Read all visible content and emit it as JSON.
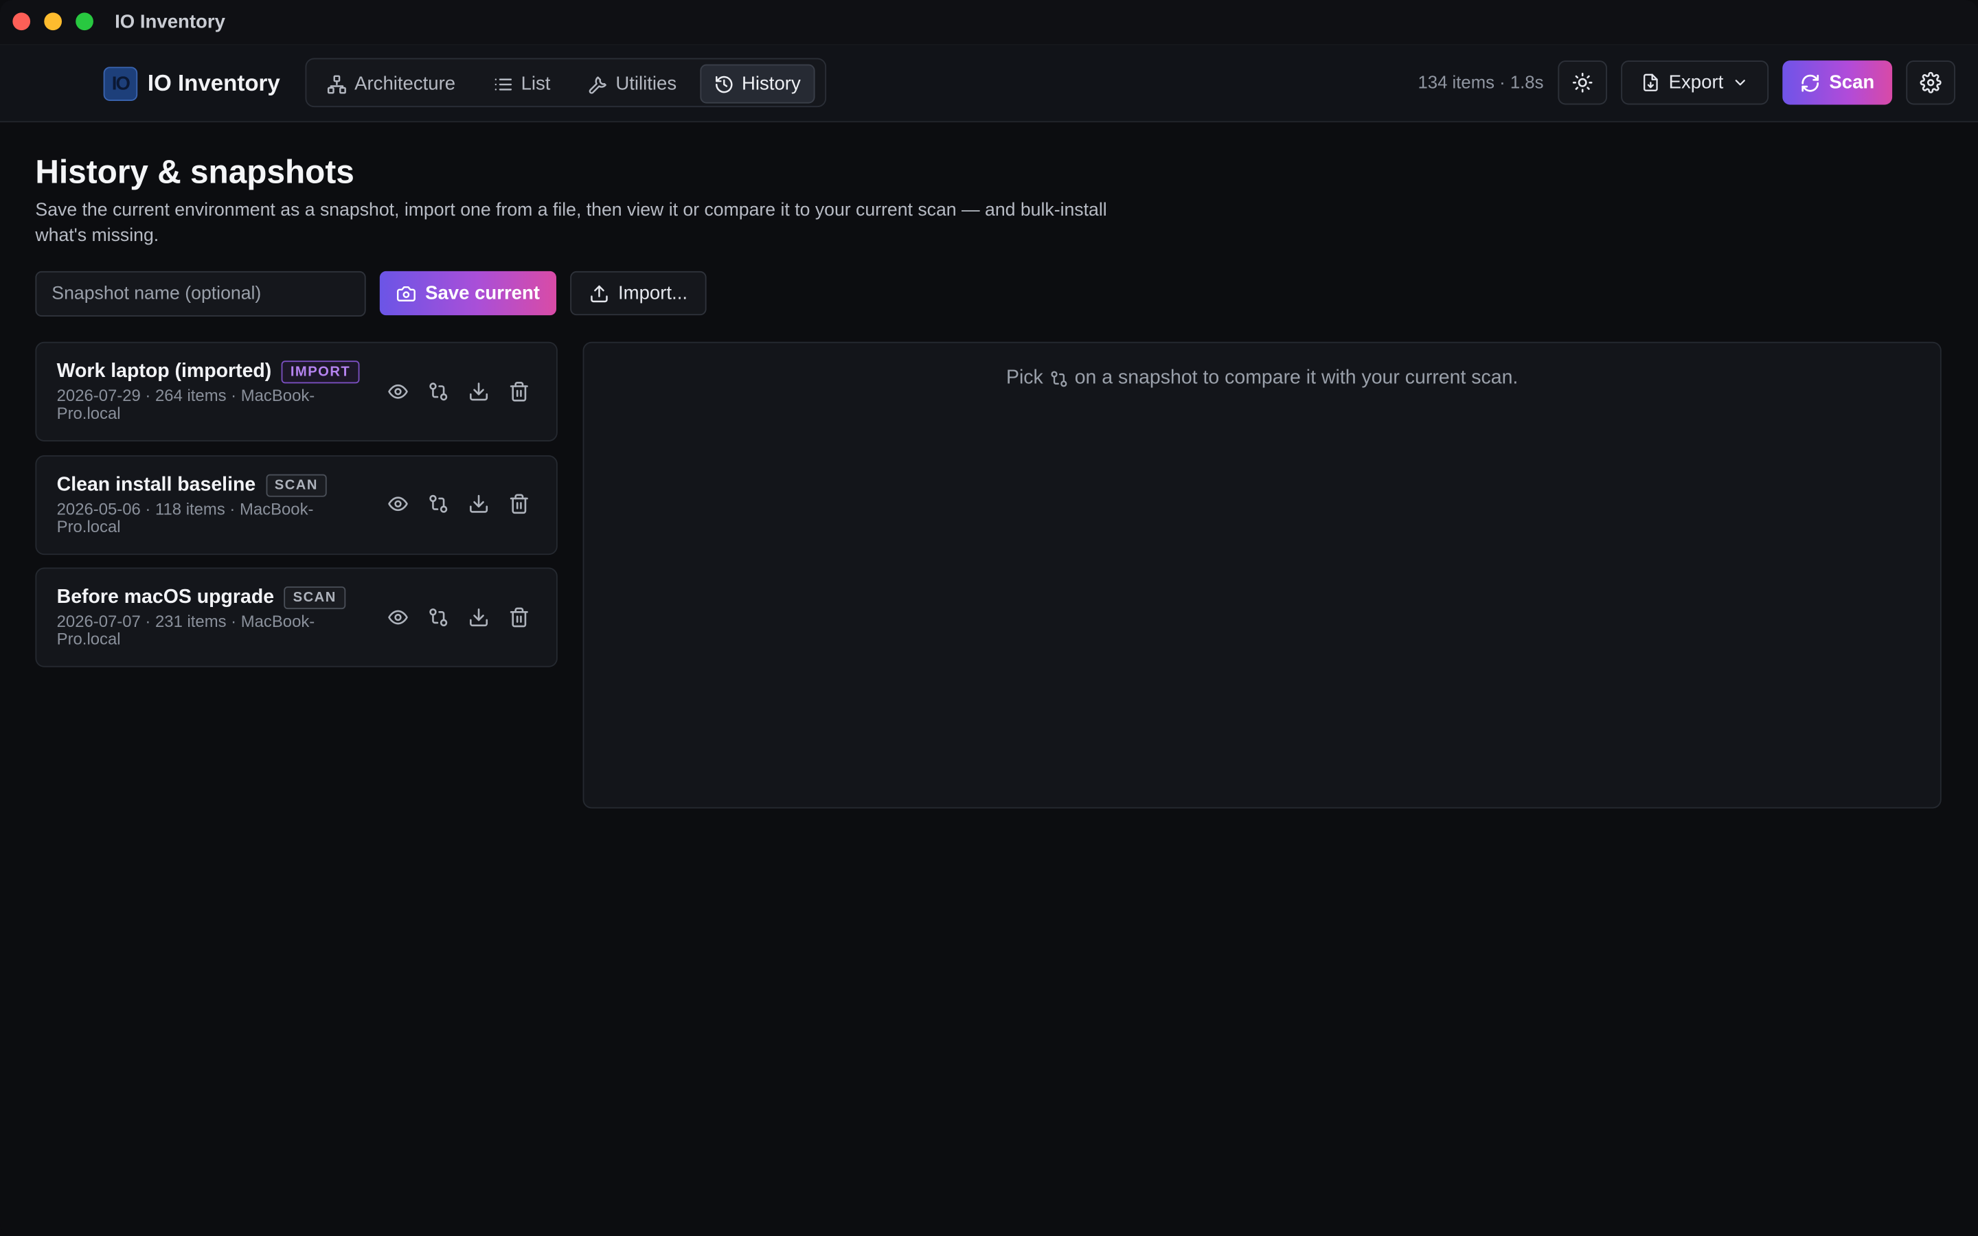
{
  "window": {
    "title": "IO Inventory"
  },
  "brand": {
    "logo_text": "IO",
    "name": "IO Inventory"
  },
  "nav": {
    "tabs": [
      {
        "label": "Architecture",
        "icon": "architecture-icon"
      },
      {
        "label": "List",
        "icon": "list-icon"
      },
      {
        "label": "Utilities",
        "icon": "wrench-icon"
      },
      {
        "label": "History",
        "icon": "history-icon",
        "active": true
      }
    ]
  },
  "header": {
    "stats": "134 items · 1.8s",
    "theme_icon": "sun-icon",
    "export_label": "Export",
    "scan_label": "Scan",
    "settings_icon": "gear-icon"
  },
  "page": {
    "title": "History & snapshots",
    "description": "Save the current environment as a snapshot, import one from a file, then view it or compare it to your current scan — and bulk-install what's missing."
  },
  "controls": {
    "name_placeholder": "Snapshot name (optional)",
    "name_value": "",
    "save_label": "Save current",
    "import_label": "Import..."
  },
  "snapshots": [
    {
      "name": "Work laptop (imported)",
      "badge": "IMPORT",
      "meta": "2026-07-29 · 264 items · MacBook-Pro.local"
    },
    {
      "name": "Clean install baseline",
      "badge": "SCAN",
      "meta": "2026-05-06 · 118 items · MacBook-Pro.local"
    },
    {
      "name": "Before macOS upgrade",
      "badge": "SCAN",
      "meta": "2026-07-07 · 231 items · MacBook-Pro.local"
    }
  ],
  "compare": {
    "hint_before": "Pick",
    "hint_after": "on a snapshot to compare it with your current scan."
  },
  "colors": {
    "background": "#0c0d10",
    "accent_gradient_start": "#6b55e6",
    "accent_gradient_end": "#d94ba6",
    "import_badge": "#b583f0"
  }
}
